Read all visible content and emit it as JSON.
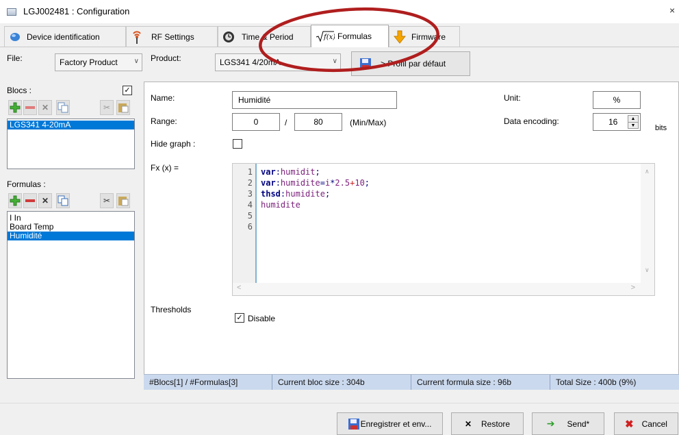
{
  "window": {
    "title": "LGJ002481 : Configuration",
    "close_glyph": "×"
  },
  "tabs": [
    {
      "label": "Device identification",
      "icon": "bubble-icon"
    },
    {
      "label": "RF Settings",
      "icon": "antenna-icon"
    },
    {
      "label": "Time & Period",
      "icon": "clock-icon"
    },
    {
      "label": "Formulas",
      "icon": "sqrt-fx-icon",
      "active": true
    },
    {
      "label": "Firmware",
      "icon": "download-arrow-icon"
    }
  ],
  "top": {
    "file_label": "File:",
    "file_value": "Factory Product",
    "product_label": "Product:",
    "product_value": "LGS341 4/20mA",
    "profile_button": "> Profil par défaut"
  },
  "blocs": {
    "label": "Blocs :",
    "checked": true,
    "items": [
      {
        "label": "LGS341 4-20mA",
        "selected": true
      }
    ]
  },
  "formulas": {
    "label": "Formulas :",
    "items": [
      {
        "label": "I In",
        "selected": false
      },
      {
        "label": "Board Temp",
        "selected": false
      },
      {
        "label": "Humidité",
        "selected": true
      }
    ]
  },
  "details": {
    "name_label": "Name:",
    "name_value": "Humidité",
    "range_label": "Range:",
    "range_min": "0",
    "range_sep": "/",
    "range_max": "80",
    "range_hint": "(Min/Max)",
    "hide_graph_label": "Hide graph :",
    "hide_graph_checked": false,
    "unit_label": "Unit:",
    "unit_value": "%",
    "encoding_label": "Data encoding:",
    "encoding_value": "16",
    "encoding_unit": "bits",
    "fx_label": "Fx (x) =",
    "thresholds_label": "Thresholds",
    "disable_label": "Disable",
    "disable_checked": true
  },
  "code": {
    "line_numbers": [
      "1",
      "2",
      "3",
      "4",
      "5",
      "6"
    ],
    "lines": [
      "var:humidit;",
      "var:humidite=i*2.5+10;",
      "thsd:humidite;",
      "humidite",
      "",
      ""
    ]
  },
  "status": {
    "counts": "#Blocs[1] / #Formulas[3]",
    "bloc_size": "Current bloc size : 304b",
    "formula_size": "Current formula size : 96b",
    "total_size": "Total Size : 400b (9%)"
  },
  "buttons": {
    "save": "Enregistrer et env...",
    "restore": "Restore",
    "send": "Send*",
    "cancel": "Cancel"
  },
  "colors": {
    "selection": "#0078d7",
    "status_bar": "#cbd9ee",
    "annotation_circle": "#b01e1e"
  }
}
